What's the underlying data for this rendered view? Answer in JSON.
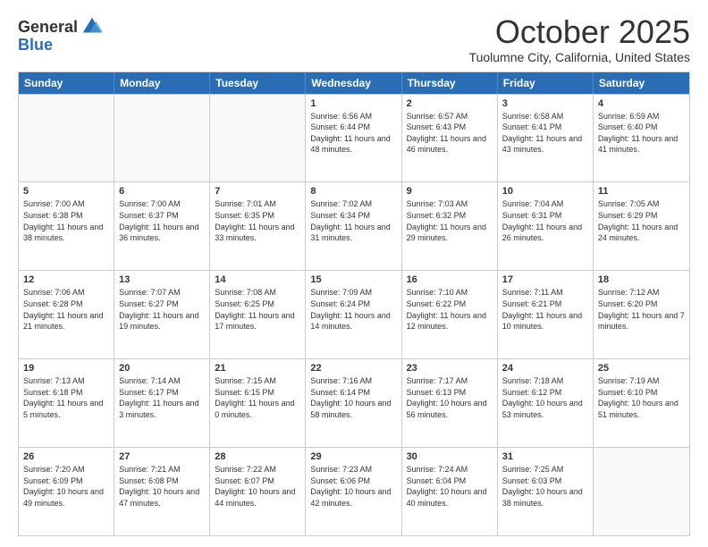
{
  "logo": {
    "general": "General",
    "blue": "Blue"
  },
  "header": {
    "month": "October 2025",
    "location": "Tuolumne City, California, United States"
  },
  "weekdays": [
    "Sunday",
    "Monday",
    "Tuesday",
    "Wednesday",
    "Thursday",
    "Friday",
    "Saturday"
  ],
  "rows": [
    [
      {
        "day": "",
        "empty": true
      },
      {
        "day": "",
        "empty": true
      },
      {
        "day": "",
        "empty": true
      },
      {
        "day": "1",
        "sunrise": "6:56 AM",
        "sunset": "6:44 PM",
        "daylight": "11 hours and 48 minutes."
      },
      {
        "day": "2",
        "sunrise": "6:57 AM",
        "sunset": "6:43 PM",
        "daylight": "11 hours and 46 minutes."
      },
      {
        "day": "3",
        "sunrise": "6:58 AM",
        "sunset": "6:41 PM",
        "daylight": "11 hours and 43 minutes."
      },
      {
        "day": "4",
        "sunrise": "6:59 AM",
        "sunset": "6:40 PM",
        "daylight": "11 hours and 41 minutes."
      }
    ],
    [
      {
        "day": "5",
        "sunrise": "7:00 AM",
        "sunset": "6:38 PM",
        "daylight": "11 hours and 38 minutes."
      },
      {
        "day": "6",
        "sunrise": "7:00 AM",
        "sunset": "6:37 PM",
        "daylight": "11 hours and 36 minutes."
      },
      {
        "day": "7",
        "sunrise": "7:01 AM",
        "sunset": "6:35 PM",
        "daylight": "11 hours and 33 minutes."
      },
      {
        "day": "8",
        "sunrise": "7:02 AM",
        "sunset": "6:34 PM",
        "daylight": "11 hours and 31 minutes."
      },
      {
        "day": "9",
        "sunrise": "7:03 AM",
        "sunset": "6:32 PM",
        "daylight": "11 hours and 29 minutes."
      },
      {
        "day": "10",
        "sunrise": "7:04 AM",
        "sunset": "6:31 PM",
        "daylight": "11 hours and 26 minutes."
      },
      {
        "day": "11",
        "sunrise": "7:05 AM",
        "sunset": "6:29 PM",
        "daylight": "11 hours and 24 minutes."
      }
    ],
    [
      {
        "day": "12",
        "sunrise": "7:06 AM",
        "sunset": "6:28 PM",
        "daylight": "11 hours and 21 minutes."
      },
      {
        "day": "13",
        "sunrise": "7:07 AM",
        "sunset": "6:27 PM",
        "daylight": "11 hours and 19 minutes."
      },
      {
        "day": "14",
        "sunrise": "7:08 AM",
        "sunset": "6:25 PM",
        "daylight": "11 hours and 17 minutes."
      },
      {
        "day": "15",
        "sunrise": "7:09 AM",
        "sunset": "6:24 PM",
        "daylight": "11 hours and 14 minutes."
      },
      {
        "day": "16",
        "sunrise": "7:10 AM",
        "sunset": "6:22 PM",
        "daylight": "11 hours and 12 minutes."
      },
      {
        "day": "17",
        "sunrise": "7:11 AM",
        "sunset": "6:21 PM",
        "daylight": "11 hours and 10 minutes."
      },
      {
        "day": "18",
        "sunrise": "7:12 AM",
        "sunset": "6:20 PM",
        "daylight": "11 hours and 7 minutes."
      }
    ],
    [
      {
        "day": "19",
        "sunrise": "7:13 AM",
        "sunset": "6:18 PM",
        "daylight": "11 hours and 5 minutes."
      },
      {
        "day": "20",
        "sunrise": "7:14 AM",
        "sunset": "6:17 PM",
        "daylight": "11 hours and 3 minutes."
      },
      {
        "day": "21",
        "sunrise": "7:15 AM",
        "sunset": "6:15 PM",
        "daylight": "11 hours and 0 minutes."
      },
      {
        "day": "22",
        "sunrise": "7:16 AM",
        "sunset": "6:14 PM",
        "daylight": "10 hours and 58 minutes."
      },
      {
        "day": "23",
        "sunrise": "7:17 AM",
        "sunset": "6:13 PM",
        "daylight": "10 hours and 56 minutes."
      },
      {
        "day": "24",
        "sunrise": "7:18 AM",
        "sunset": "6:12 PM",
        "daylight": "10 hours and 53 minutes."
      },
      {
        "day": "25",
        "sunrise": "7:19 AM",
        "sunset": "6:10 PM",
        "daylight": "10 hours and 51 minutes."
      }
    ],
    [
      {
        "day": "26",
        "sunrise": "7:20 AM",
        "sunset": "6:09 PM",
        "daylight": "10 hours and 49 minutes."
      },
      {
        "day": "27",
        "sunrise": "7:21 AM",
        "sunset": "6:08 PM",
        "daylight": "10 hours and 47 minutes."
      },
      {
        "day": "28",
        "sunrise": "7:22 AM",
        "sunset": "6:07 PM",
        "daylight": "10 hours and 44 minutes."
      },
      {
        "day": "29",
        "sunrise": "7:23 AM",
        "sunset": "6:06 PM",
        "daylight": "10 hours and 42 minutes."
      },
      {
        "day": "30",
        "sunrise": "7:24 AM",
        "sunset": "6:04 PM",
        "daylight": "10 hours and 40 minutes."
      },
      {
        "day": "31",
        "sunrise": "7:25 AM",
        "sunset": "6:03 PM",
        "daylight": "10 hours and 38 minutes."
      },
      {
        "day": "",
        "empty": true
      }
    ]
  ],
  "labels": {
    "sunrise": "Sunrise:",
    "sunset": "Sunset:",
    "daylight": "Daylight:"
  }
}
